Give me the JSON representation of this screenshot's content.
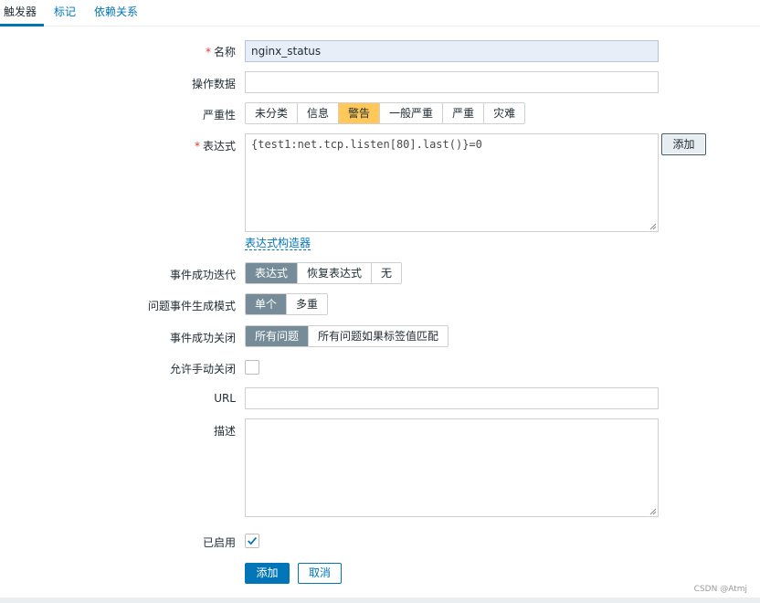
{
  "tabs": [
    {
      "label": "触发器",
      "active": true
    },
    {
      "label": "标记",
      "active": false
    },
    {
      "label": "依赖关系",
      "active": false
    }
  ],
  "form": {
    "name": {
      "label": "名称",
      "required": true,
      "value": "nginx_status"
    },
    "opdata": {
      "label": "操作数据",
      "value": ""
    },
    "severity": {
      "label": "严重性",
      "options": [
        "未分类",
        "信息",
        "警告",
        "一般严重",
        "严重",
        "灾难"
      ],
      "selected": "警告",
      "selected_color": "#ffc859"
    },
    "expression": {
      "label": "表达式",
      "required": true,
      "value": "{test1:net.tcp.listen[80].last()}=0",
      "add_button": "添加",
      "constructor_link": "表达式构造器"
    },
    "ok_event_gen": {
      "label": "事件成功迭代",
      "options": [
        "表达式",
        "恢复表达式",
        "无"
      ],
      "selected": "表达式"
    },
    "problem_mode": {
      "label": "问题事件生成模式",
      "options": [
        "单个",
        "多重"
      ],
      "selected": "单个"
    },
    "ok_close": {
      "label": "事件成功关闭",
      "options": [
        "所有问题",
        "所有问题如果标签值匹配"
      ],
      "selected": "所有问题"
    },
    "manual_close": {
      "label": "允许手动关闭",
      "checked": false
    },
    "url": {
      "label": "URL",
      "value": ""
    },
    "description": {
      "label": "描述",
      "value": ""
    },
    "enabled": {
      "label": "已启用",
      "checked": true
    }
  },
  "actions": {
    "add": "添加",
    "cancel": "取消"
  },
  "watermark": "CSDN @Atmj",
  "colors": {
    "accent": "#0275b8",
    "selected_segment": "#768d99",
    "required": "#e33734"
  }
}
